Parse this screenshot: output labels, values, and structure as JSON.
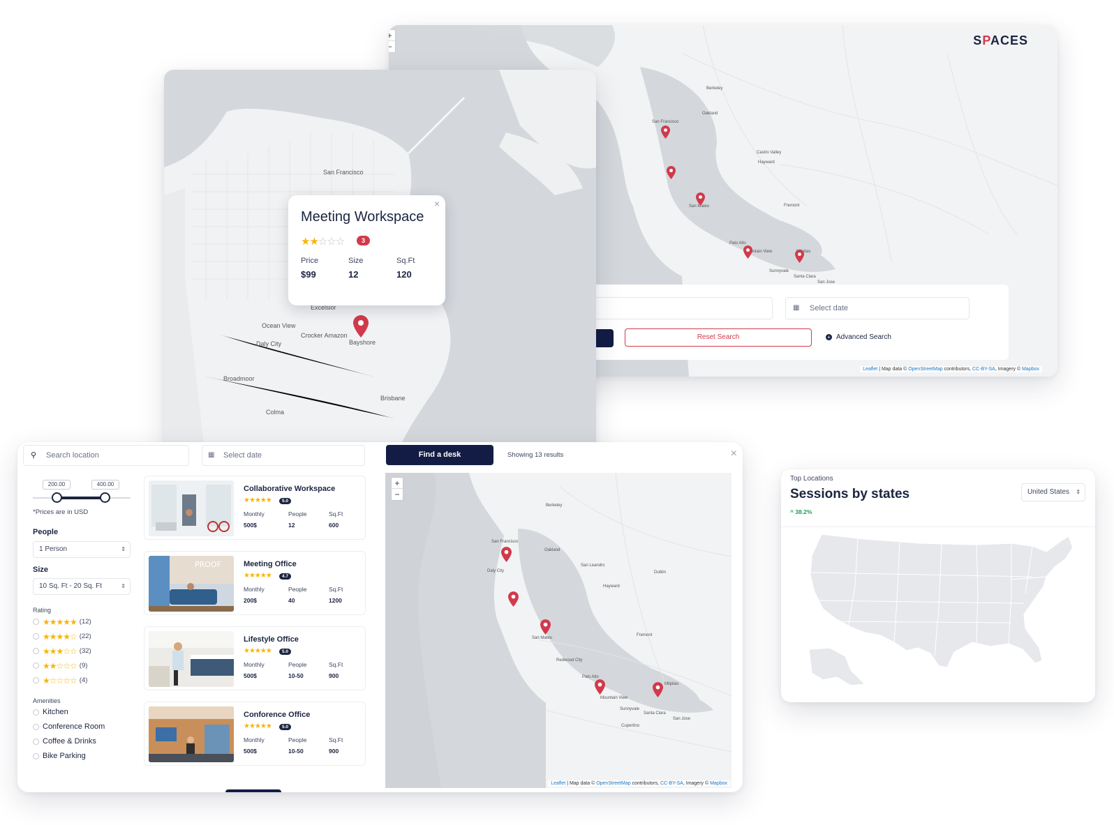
{
  "back_map": {
    "brand": {
      "prefix": "S",
      "accent": "P",
      "suffix": "ACES"
    },
    "zoom": {
      "in": "+",
      "out": "−"
    },
    "search": {
      "date_placeholder": "Select date",
      "reset_label": "Reset Search",
      "advanced_label": "Advanced Search"
    },
    "attribution": {
      "leaflet": "Leaflet",
      "sep1": " | Map data © ",
      "osm": "OpenStreetMap",
      "sep2": " contributors, ",
      "cc": "CC-BY-SA",
      "sep3": ", Imagery © ",
      "mapbox": "Mapbox"
    },
    "places": [
      "San Francisco",
      "San Mateo",
      "Palo Alto",
      "Mountain View",
      "Milpitas",
      "Sunnyvale",
      "Santa Clara",
      "San Jose",
      "Oakland",
      "Berkeley",
      "Fremont",
      "Hayward",
      "Castro Valley"
    ]
  },
  "mid_map": {
    "popup": {
      "title": "Meeting Workspace",
      "stars_filled": 2,
      "stars_total": 5,
      "review_count": "3",
      "stats": [
        {
          "label": "Price",
          "value": "$99"
        },
        {
          "label": "Size",
          "value": "12"
        },
        {
          "label": "Sq.Ft",
          "value": "120"
        }
      ],
      "close": "×"
    },
    "places": [
      "San Francisco",
      "Daly City",
      "Broadmoor",
      "Colma",
      "Brisbane",
      "Bayshore",
      "Excelsior",
      "Ocean View",
      "Crocker Amazon"
    ]
  },
  "front": {
    "search_placeholder": "Search location",
    "date_placeholder": "Select date",
    "find_label": "Find a desk",
    "results_text": "Showing 13 results",
    "close": "×",
    "filters": {
      "price_min": "200.00",
      "price_max": "400.00",
      "price_note": "*Prices are in USD",
      "people_label": "People",
      "people_value": "1 Person",
      "size_label": "Size",
      "size_value": "10 Sq. Ft - 20 Sq. Ft",
      "rating_label": "Rating",
      "ratings": [
        {
          "stars": 5,
          "count": "(12)"
        },
        {
          "stars": 4,
          "count": "(22)"
        },
        {
          "stars": 3,
          "count": "(32)"
        },
        {
          "stars": 2,
          "count": "(9)"
        },
        {
          "stars": 1,
          "count": "(4)"
        }
      ],
      "amenities_label": "Amenities",
      "amenities": [
        "Kitchen",
        "Conference Room",
        "Coffee & Drinks",
        "Bike Parking"
      ]
    },
    "listings": [
      {
        "title": "Collaborative Workspace",
        "rating": "5.0",
        "stars": "★★★★★",
        "labels": [
          "Monthly",
          "People",
          "Sq.Ft"
        ],
        "values": [
          "500$",
          "12",
          "600"
        ]
      },
      {
        "title": "Meeting Office",
        "rating": "4.7",
        "stars": "★★★★★",
        "labels": [
          "Monthly",
          "People",
          "Sq.Ft"
        ],
        "values": [
          "200$",
          "40",
          "1200"
        ]
      },
      {
        "title": "Lifestyle Office",
        "rating": "5.0",
        "stars": "★★★★★",
        "labels": [
          "Monthly",
          "People",
          "Sq.Ft"
        ],
        "values": [
          "500$",
          "10-50",
          "900"
        ]
      },
      {
        "title": "Conforence Office",
        "rating": "5.0",
        "stars": "★★★★★",
        "labels": [
          "Monthly",
          "People",
          "Sq.Ft"
        ],
        "values": [
          "500$",
          "10-50",
          "900"
        ]
      }
    ],
    "map": {
      "zoom_in": "+",
      "zoom_out": "−",
      "places": [
        "San Francisco",
        "Oakland",
        "Berkeley",
        "Daly City",
        "San Mateo",
        "Hayward",
        "Fremont",
        "Redwood City",
        "Palo Alto",
        "Mountain View",
        "Sunnyvale",
        "Santa Clara",
        "San Jose",
        "Cupertino",
        "Milpitas",
        "San Leandro",
        "Dublin"
      ]
    }
  },
  "stats": {
    "kicker": "Top Locations",
    "title": "Sessions by states",
    "trend": "^ 38.2%",
    "select_value": "United States"
  },
  "colors": {
    "navy": "#121c44",
    "brand_red": "#d13a4b",
    "star": "#f5b50a",
    "map_land": "#f2f3f4",
    "map_water": "#d4d8dc",
    "trend_green": "#1f9d55"
  }
}
